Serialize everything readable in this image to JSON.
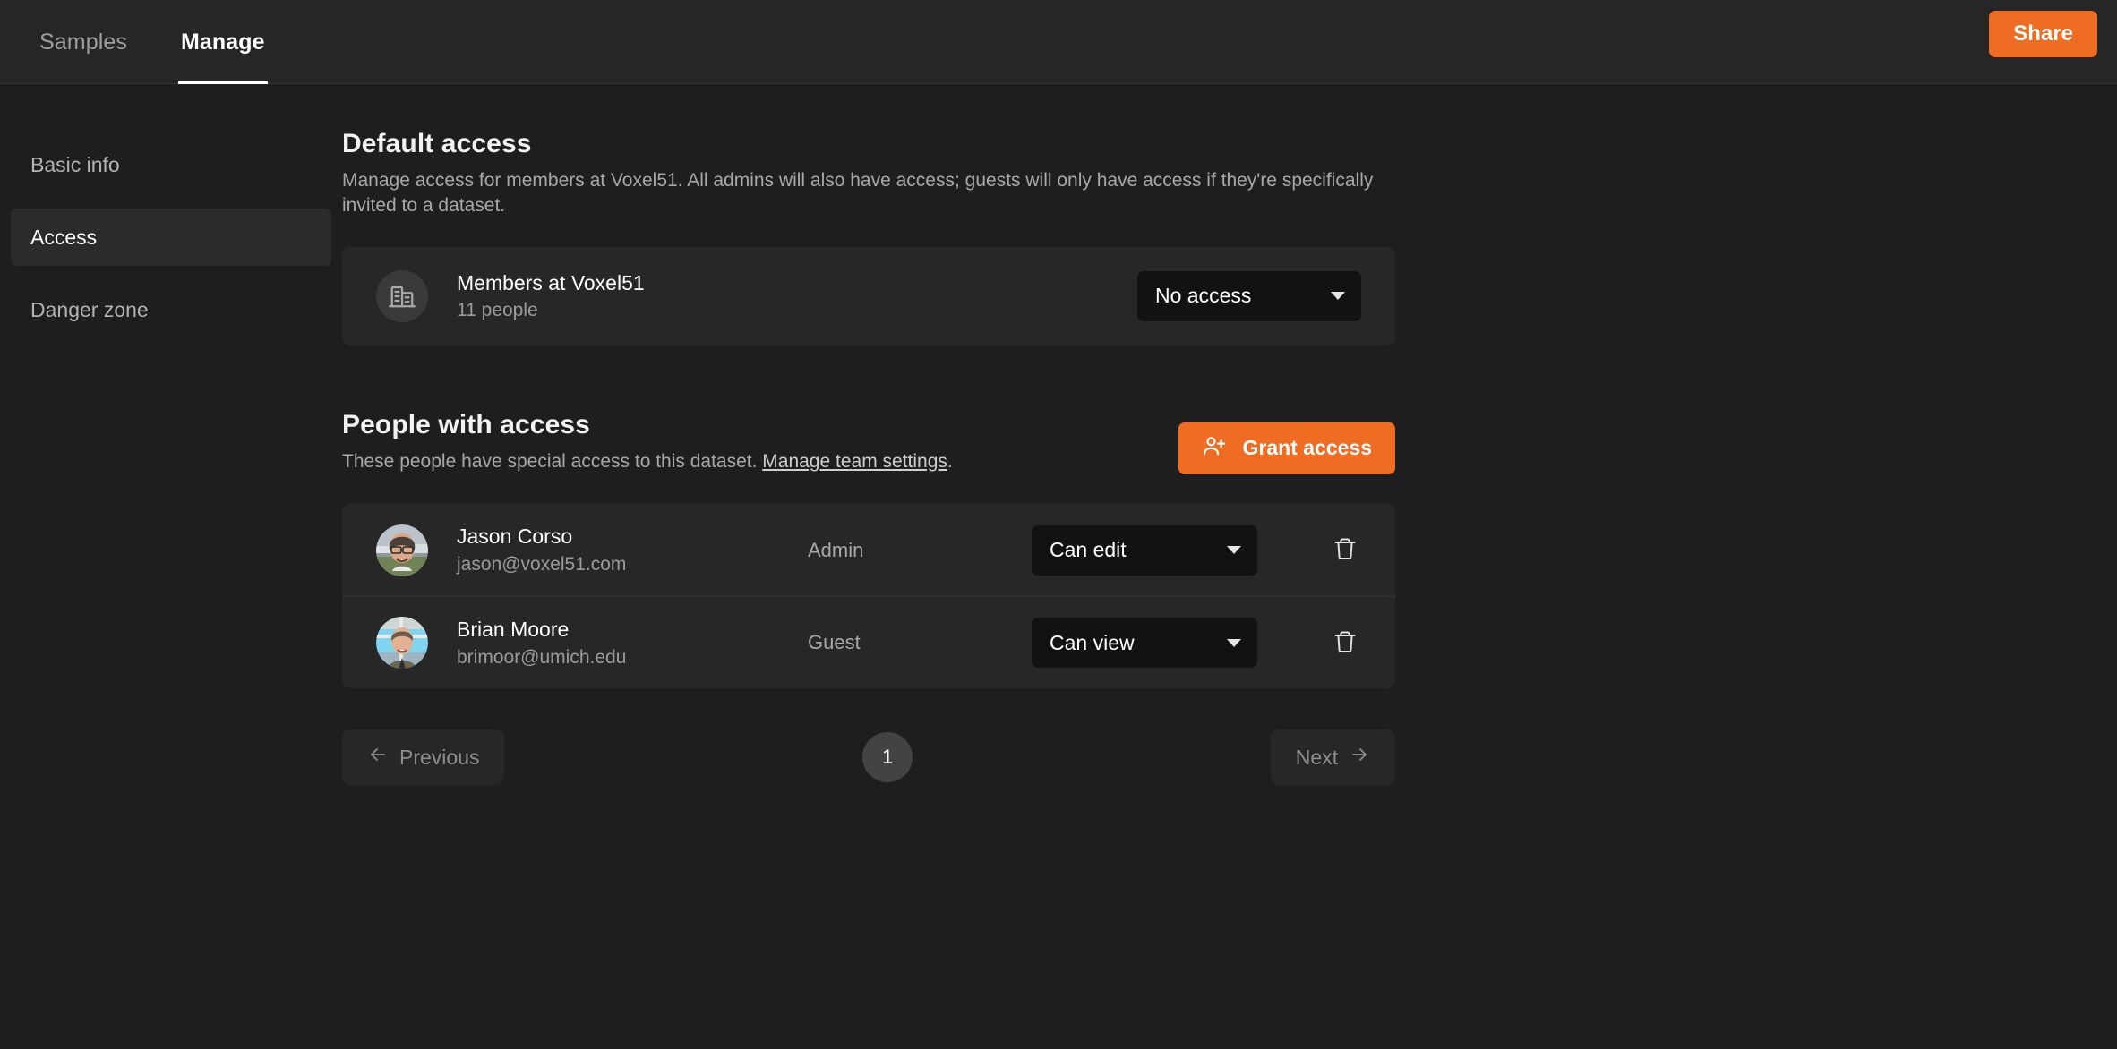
{
  "topbar": {
    "tabs": [
      {
        "label": "Samples",
        "active": false
      },
      {
        "label": "Manage",
        "active": true
      }
    ],
    "share_label": "Share"
  },
  "sidebar": {
    "items": [
      {
        "label": "Basic info",
        "active": false
      },
      {
        "label": "Access",
        "active": true
      },
      {
        "label": "Danger zone",
        "active": false
      }
    ]
  },
  "default_access": {
    "title": "Default access",
    "description": "Manage access for members at Voxel51. All admins will also have access; guests will only have access if they're specifically invited to a dataset.",
    "org_row": {
      "icon": "building-icon",
      "name": "Members at Voxel51",
      "meta": "11 people",
      "access": "No access"
    }
  },
  "people_with_access": {
    "title": "People with access",
    "description_before": "These people have special access to this dataset. ",
    "link_label": "Manage team settings",
    "description_after": ".",
    "grant_button": {
      "icon": "person-add-icon",
      "label": "Grant access"
    },
    "rows": [
      {
        "name": "Jason Corso",
        "email": "jason@voxel51.com",
        "role": "Admin",
        "permission": "Can edit",
        "delete_icon": "trash-icon"
      },
      {
        "name": "Brian Moore",
        "email": "brimoor@umich.edu",
        "role": "Guest",
        "permission": "Can view",
        "delete_icon": "trash-icon"
      }
    ]
  },
  "pagination": {
    "previous_label": "Previous",
    "current_page": "1",
    "next_label": "Next"
  },
  "colors": {
    "accent": "#ef6c23",
    "topbar_bg": "#262626",
    "page_bg": "#1e1e1e",
    "card_bg": "#272727",
    "select_bg": "#121212"
  }
}
